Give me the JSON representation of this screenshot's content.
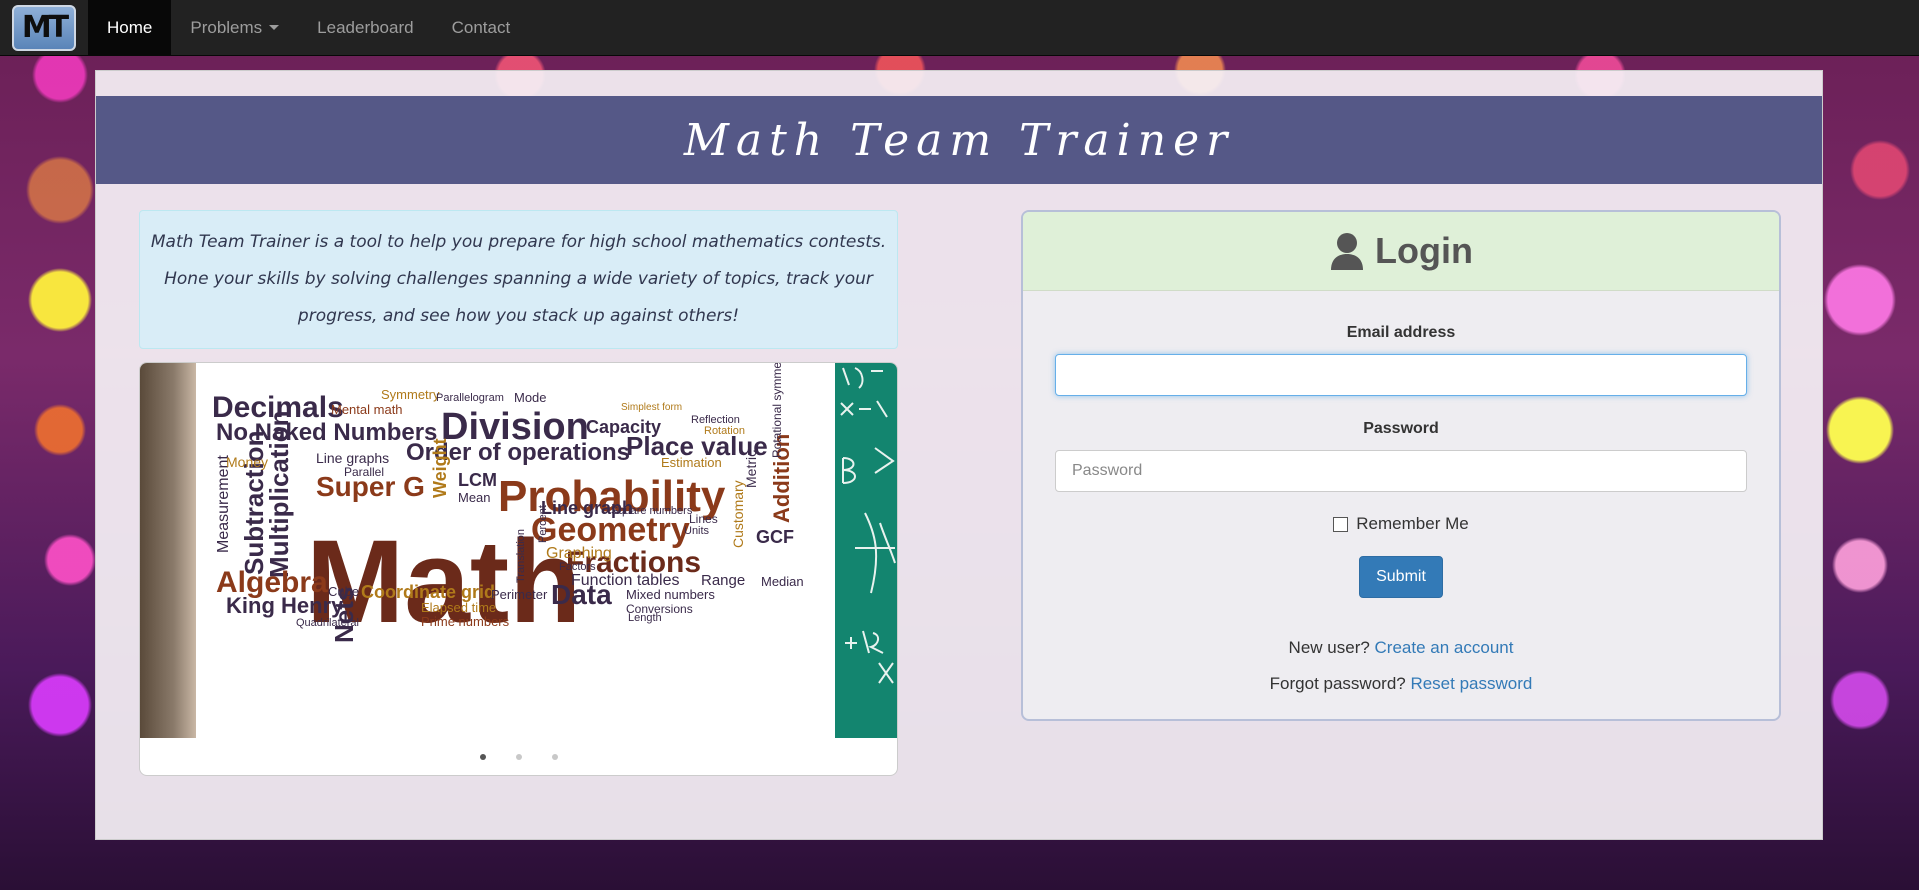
{
  "navbar": {
    "logo_text": "MT",
    "items": [
      {
        "label": "Home",
        "active": true
      },
      {
        "label": "Problems",
        "dropdown": true
      },
      {
        "label": "Leaderboard"
      },
      {
        "label": "Contact"
      }
    ]
  },
  "jumbotron": {
    "title": "Math Team Trainer"
  },
  "intro": {
    "text": "Math Team Trainer is a tool to help you prepare for high school mathematics contests. Hone your skills by solving challenges spanning a wide variety of topics, track your progress, and see how you stack up against others!"
  },
  "carousel": {
    "slide_count": 3,
    "active_index": 0,
    "wordcloud_words": [
      "Math",
      "Probability",
      "Division",
      "Geometry",
      "Fractions",
      "Decimals",
      "Multiplication",
      "Algebra",
      "Subtraction",
      "Order of operations",
      "Place value",
      "No Naked Numbers",
      "Data",
      "Nets",
      "King Henry",
      "Coordinate grid",
      "Addition",
      "Super G",
      "Line graph",
      "Measurement",
      "Capacity",
      "Function tables",
      "Graphing",
      "Mixed numbers",
      "Elapsed time",
      "Prime numbers",
      "Perimeter",
      "Cube",
      "GCF",
      "LCM",
      "Mean",
      "Range",
      "Weight",
      "Money",
      "Line graphs",
      "Mental math",
      "Symmetry",
      "Metric",
      "Customary",
      "Rotational symmetry",
      "Median",
      "Conversions",
      "Estimation",
      "Mode",
      "Parallel",
      "Quadrilateral",
      "Length",
      "Units",
      "Lines",
      "Translation",
      "Percent",
      "Factors",
      "Reflection",
      "Rotation",
      "Parallelogram",
      "Square numbers",
      "Simplest form"
    ]
  },
  "login": {
    "title": "Login",
    "email_label": "Email address",
    "email_value": "",
    "password_label": "Password",
    "password_placeholder": "Password",
    "remember_label": "Remember Me",
    "remember_checked": false,
    "submit_label": "Submit",
    "new_user_text": "New user?",
    "create_account_link": "Create an account",
    "forgot_text": "Forgot password?",
    "reset_link": "Reset password"
  },
  "colors": {
    "navbar": "#222222",
    "jumbotron": "#555887",
    "info_bg": "#d9edf7",
    "panel_heading": "#dff0d8",
    "primary": "#337ab7"
  }
}
